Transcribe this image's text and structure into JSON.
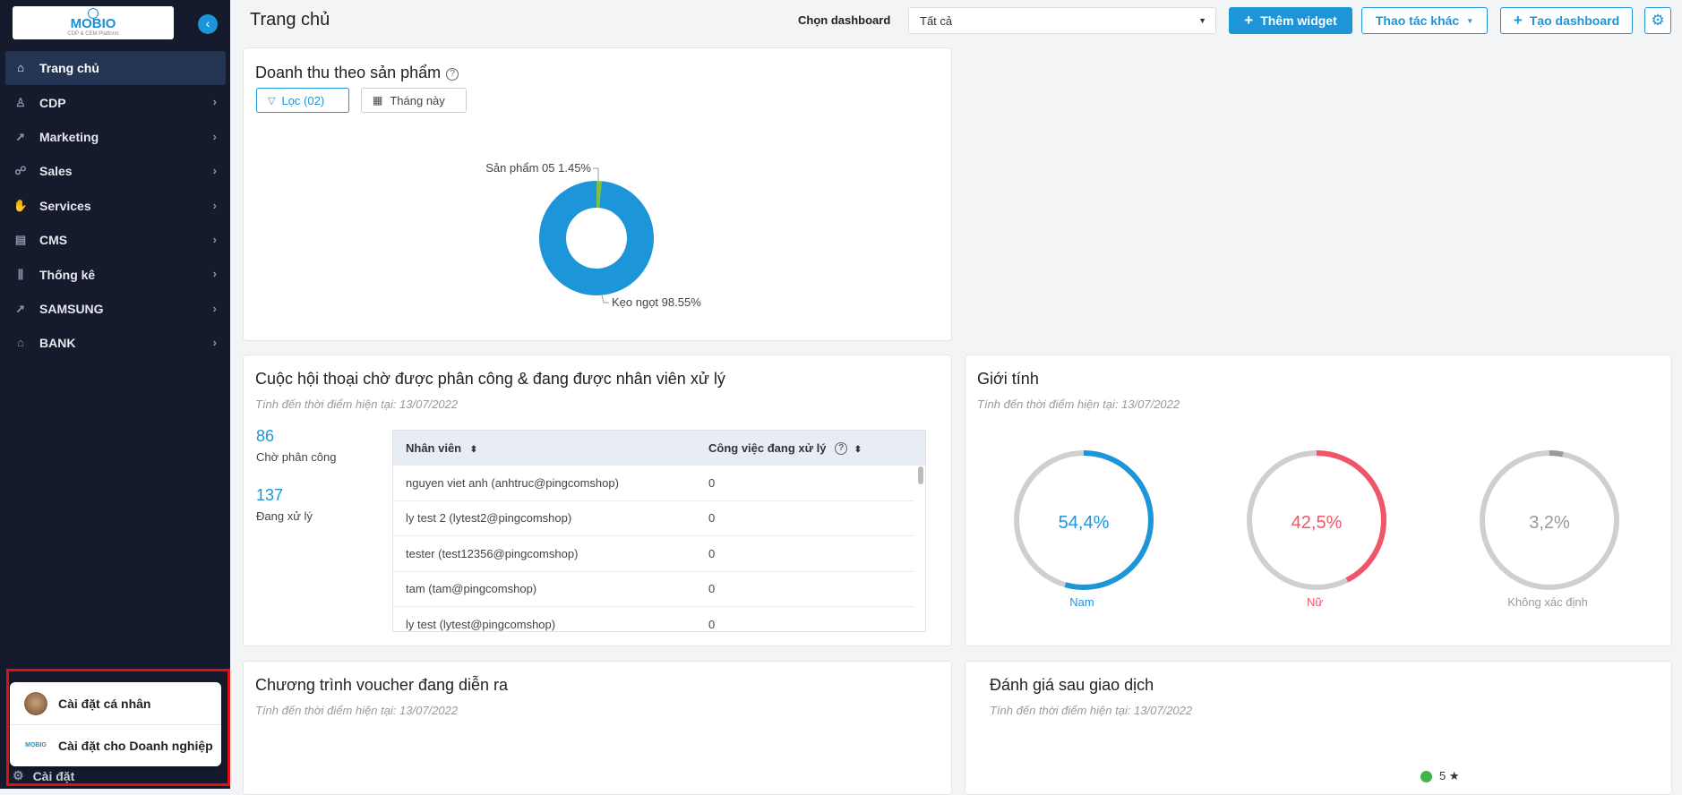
{
  "sidebar": {
    "logo_text": "MOBIO",
    "logo_sub": "CDP & CEM Platform",
    "items": [
      {
        "label": "Trang chủ",
        "icon": "home-icon"
      },
      {
        "label": "CDP",
        "icon": "user-icon"
      },
      {
        "label": "Marketing",
        "icon": "rocket-icon"
      },
      {
        "label": "Sales",
        "icon": "handshake-icon"
      },
      {
        "label": "Services",
        "icon": "service-icon"
      },
      {
        "label": "CMS",
        "icon": "cms-icon"
      },
      {
        "label": "Thống kê",
        "icon": "chart-icon"
      },
      {
        "label": "SAMSUNG",
        "icon": "rocket-icon"
      },
      {
        "label": "BANK",
        "icon": "bank-icon"
      }
    ],
    "popup": {
      "personal": "Cài đặt cá nhân",
      "business": "Cài đặt cho Doanh nghiệp"
    },
    "settings_label": "Cài đặt"
  },
  "header": {
    "title": "Trang chủ",
    "dashboard_label": "Chọn dashboard",
    "dashboard_value": "Tất cả",
    "add_widget": "Thêm widget",
    "other_actions": "Thao tác khác",
    "create_dashboard": "Tạo dashboard"
  },
  "revenue": {
    "title": "Doanh thu theo sản phẩm",
    "filter": "Lọc (02)",
    "period": "Tháng này",
    "label_small": "Sản phẩm 05 1.45%",
    "label_large": "Kẹo ngọt 98.55%"
  },
  "chart_data": {
    "type": "pie",
    "categories": [
      "Kẹo ngọt",
      "Sản phẩm 05"
    ],
    "values": [
      98.55,
      1.45
    ],
    "colors": [
      "#1d95d9",
      "#7cc242"
    ],
    "title": "Doanh thu theo sản phẩm"
  },
  "conversations": {
    "title": "Cuộc hội thoại chờ được phân công & đang được nhân viên xử lý",
    "subtitle": "Tính đến thời điểm hiện tại: 13/07/2022",
    "waiting_count": "86",
    "waiting_label": "Chờ phân công",
    "processing_count": "137",
    "processing_label": "Đang xử lý",
    "columns": [
      "Nhân viên",
      "Công việc đang xử lý"
    ],
    "rows": [
      {
        "name": "nguyen viet anh (anhtruc@pingcomshop)",
        "count": "0"
      },
      {
        "name": "ly test 2 (lytest2@pingcomshop)",
        "count": "0"
      },
      {
        "name": "tester (test12356@pingcomshop)",
        "count": "0"
      },
      {
        "name": "tam (tam@pingcomshop)",
        "count": "0"
      },
      {
        "name": "ly test (lytest@pingcomshop)",
        "count": "0"
      }
    ]
  },
  "gender": {
    "title": "Giới tính",
    "subtitle": "Tính đến thời điểm hiện tại: 13/07/2022",
    "items": [
      {
        "label": "Nam",
        "value": "54,4%",
        "fraction": 0.544,
        "color": "#1d95d9"
      },
      {
        "label": "Nữ",
        "value": "42,5%",
        "fraction": 0.425,
        "color": "#f0566a"
      },
      {
        "label": "Không xác định",
        "value": "3,2%",
        "fraction": 0.032,
        "color": "#999999"
      }
    ]
  },
  "voucher": {
    "title": "Chương trình voucher đang diễn ra",
    "subtitle": "Tính đến thời điểm hiện tại: 13/07/2022"
  },
  "rating": {
    "title": "Đánh giá sau giao dịch",
    "subtitle": "Tính đến thời điểm hiện tại: 13/07/2022",
    "legend_label": "5 ★"
  }
}
